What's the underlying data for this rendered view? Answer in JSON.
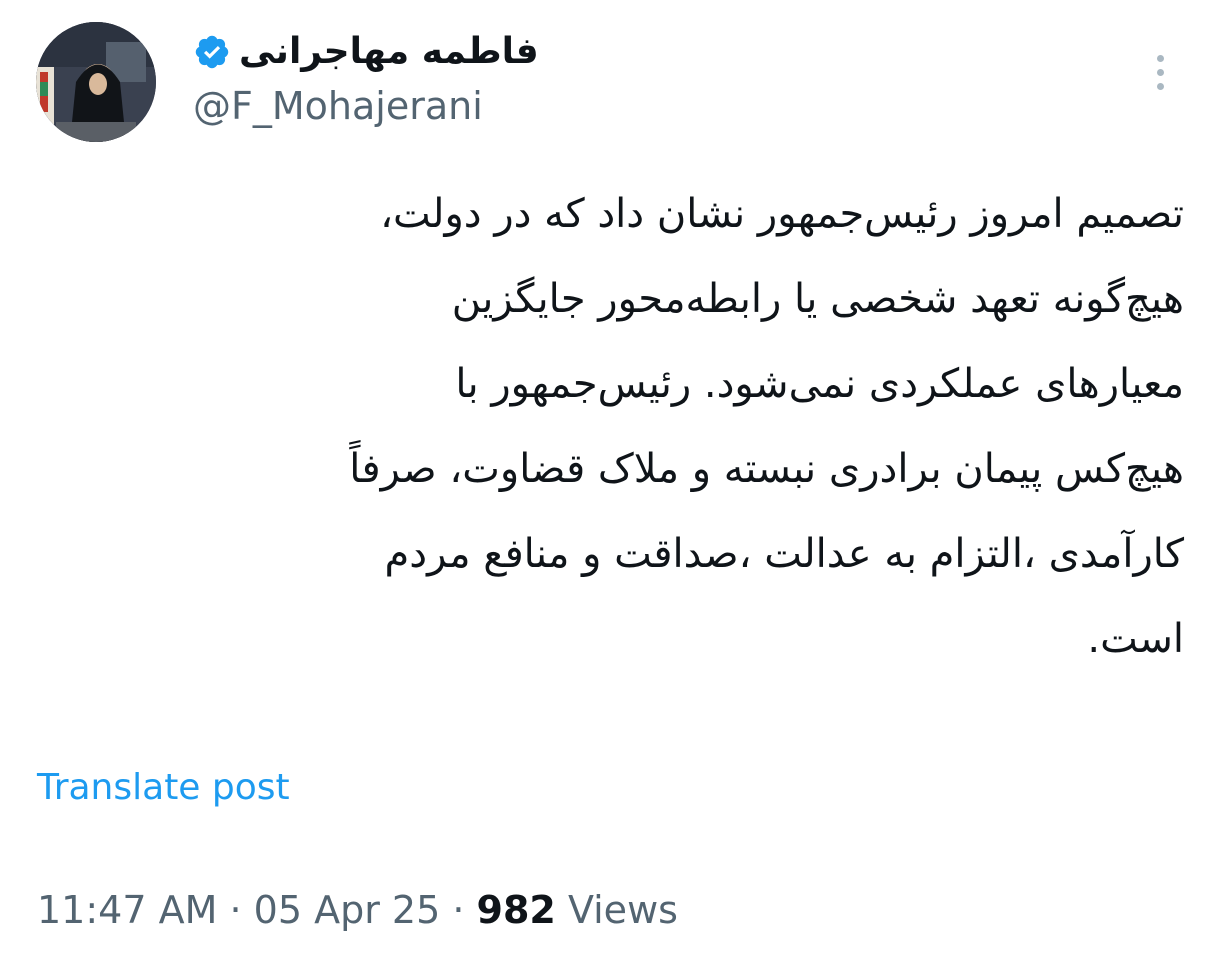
{
  "author": {
    "display_name": "فاطمه مهاجرانی",
    "handle": "@F_Mohajerani",
    "verified": true,
    "avatar_icon": "avatar-photo",
    "verified_icon": "verified-badge-icon",
    "more_icon": "more-options-icon"
  },
  "post": {
    "lines": [
      "تصمیم امروز رئیس‌جمهور نشان داد که در دولت،",
      "هیچ‌گونه تعهد شخصی یا رابطه‌محور جایگزین",
      "معیارهای عملکردی نمی‌شود. رئیس‌جمهور با",
      "هیچ‌کس پیمان برادری نبسته و ملاک قضاوت، صرفاً",
      "کارآمدی ،التزام به عدالت ،صداقت و منافع مردم",
      "است."
    ]
  },
  "translate_label": "Translate post",
  "meta": {
    "time": "11:47 AM",
    "separator": "·",
    "date": "05 Apr 25",
    "views_count": "982",
    "views_label": "Views"
  },
  "colors": {
    "text_primary": "#0f1419",
    "text_secondary": "#536471",
    "accent_link": "#1d9bf0",
    "verified_badge": "#1d9bf0"
  }
}
